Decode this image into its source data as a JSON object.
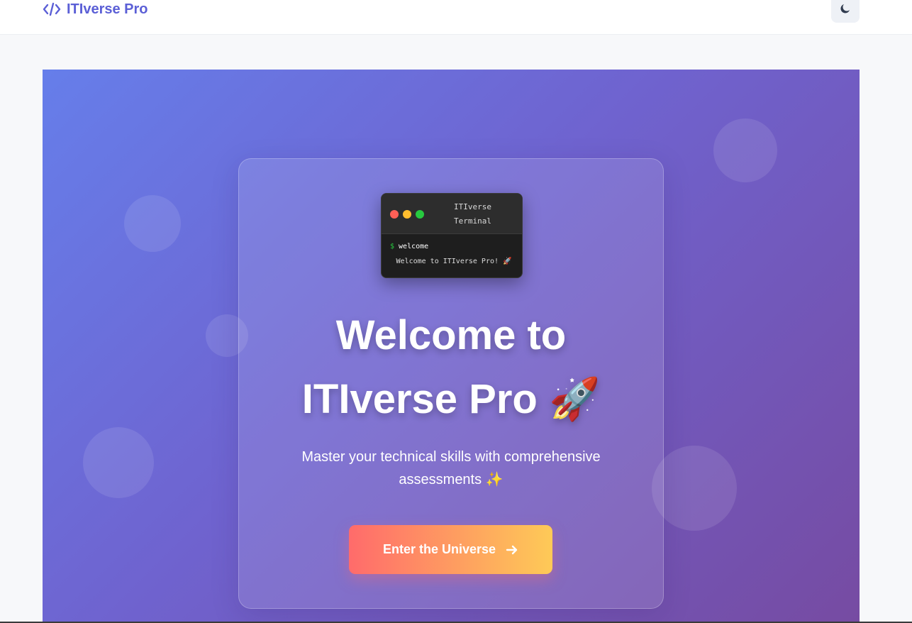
{
  "brand": {
    "symbol": "</>",
    "name": "ITIverse Pro",
    "color": "#5b5fd6"
  },
  "header": {
    "theme_toggle_icon": "moon-icon"
  },
  "terminal": {
    "title": "ITIverse Terminal",
    "prompt": "$",
    "command": "welcome",
    "output": "Welcome to ITIverse Pro! 🚀"
  },
  "hero": {
    "headline_line1": "Welcome to",
    "headline_line2": "ITIverse Pro 🚀",
    "subtitle": "Master your technical skills with comprehensive assessments ✨",
    "cta_label": "Enter the Universe",
    "cta_icon": "arrow-right-icon",
    "gradient_start": "#667eea",
    "gradient_end": "#764ba2",
    "cta_gradient_start": "#ff6b6b",
    "cta_gradient_end": "#feca57"
  }
}
